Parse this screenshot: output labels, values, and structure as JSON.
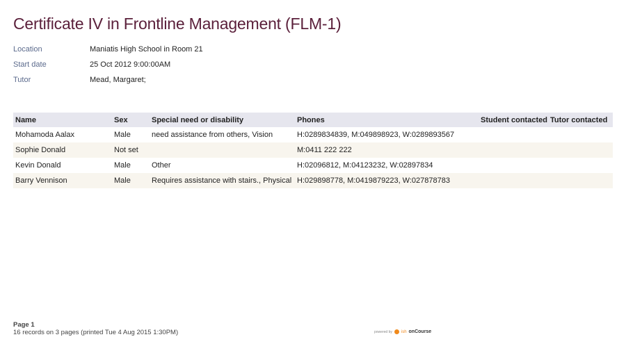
{
  "title": "Certificate IV in Frontline Management (FLM-1)",
  "meta": [
    {
      "label": "Location",
      "value": "Maniatis High School in Room 21"
    },
    {
      "label": "Start date",
      "value": "25 Oct 2012 9:00:00AM"
    },
    {
      "label": "Tutor",
      "value": "Mead, Margaret;"
    }
  ],
  "table": {
    "headers": [
      "Name",
      "Sex",
      "Special need or disability",
      "Phones",
      "Student contacted",
      "Tutor contacted"
    ],
    "rows": [
      [
        "Mohamoda Aalax",
        "Male",
        "need assistance from others, Vision",
        "H:0289834839, M:049898923, W:0289893567",
        "",
        ""
      ],
      [
        "Sophie Donald",
        "Not set",
        "",
        "M:0411 222 222",
        "",
        ""
      ],
      [
        "Kevin Donald",
        "Male",
        "Other",
        "H:02096812, M:04123232, W:02897834",
        "",
        ""
      ],
      [
        "Barry Vennison",
        "Male",
        "Requires assistance with stairs., Physical",
        "H:029898778, M:0419879223, W:027878783",
        "",
        ""
      ]
    ]
  },
  "footer": {
    "page_label": "Page",
    "page_number": "1",
    "records_text": "16 records on 3 pages (printed Tue 4 Aug 2015 1:30PM)"
  },
  "powered_by": {
    "prefix": "powered by",
    "brand_ish": "ish",
    "brand_name": "onCourse",
    "icon": "ish-logo-icon",
    "accent_color": "#f08a1c"
  },
  "colors": {
    "title": "#5a1f3a",
    "meta_label": "#5b6a8c",
    "header_bg": "#e6e6ee",
    "alt_row_bg": "#f8f5ee"
  }
}
